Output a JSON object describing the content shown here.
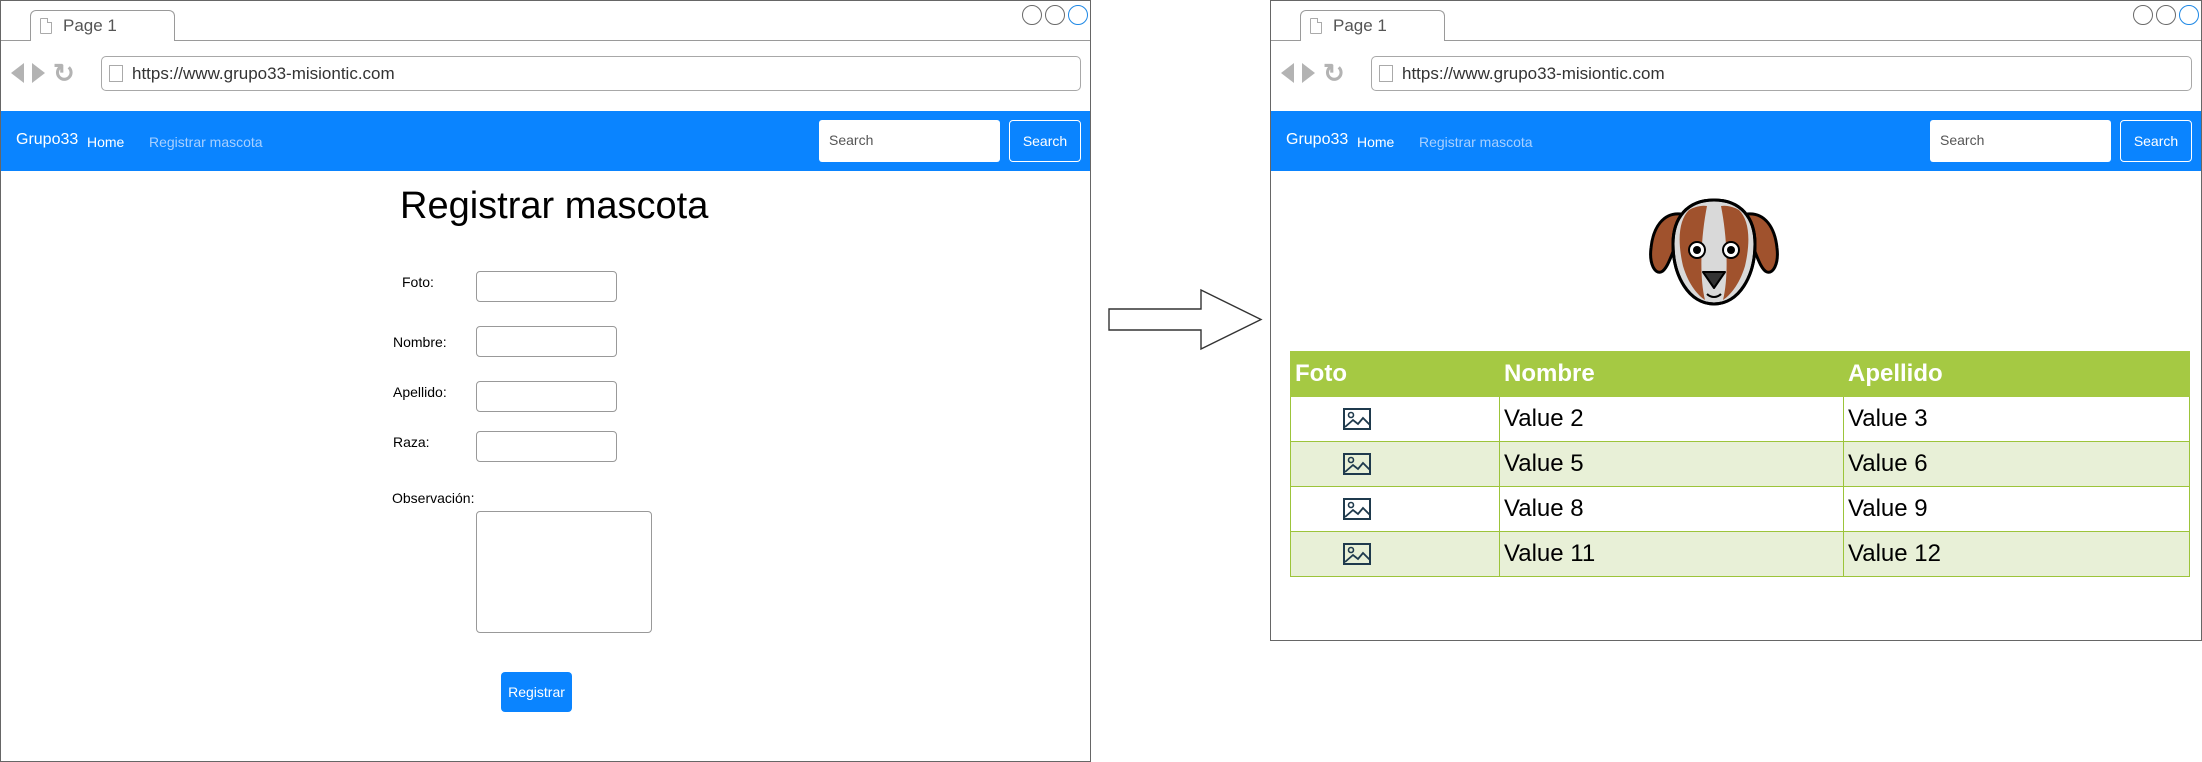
{
  "windows": {
    "form": {
      "tab_title": "Page 1",
      "url": "https://www.grupo33-misiontic.com",
      "navbar": {
        "brand": "Grupo33",
        "home": "Home",
        "register": "Registrar mascota",
        "search_placeholder": "Search",
        "search_button": "Search"
      },
      "title": "Registrar mascota",
      "labels": {
        "foto": "Foto:",
        "nombre": "Nombre:",
        "apellido": "Apellido:",
        "raza": "Raza:",
        "observacion": "Observación:"
      },
      "submit": "Registrar"
    },
    "list": {
      "tab_title": "Page 1",
      "url": "https://www.grupo33-misiontic.com",
      "navbar": {
        "brand": "Grupo33",
        "home": "Home",
        "register": "Registrar mascota",
        "search_placeholder": "Search",
        "search_button": "Search"
      },
      "table": {
        "headers": [
          "Foto",
          "Nombre",
          "Apellido"
        ],
        "rows": [
          {
            "nombre": "Value 2",
            "apellido": "Value 3"
          },
          {
            "nombre": "Value 5",
            "apellido": "Value 6"
          },
          {
            "nombre": "Value 8",
            "apellido": "Value 9"
          },
          {
            "nombre": "Value 11",
            "apellido": "Value 12"
          }
        ]
      }
    }
  },
  "colors": {
    "navbar": "#0a84ff",
    "table_header": "#a5c943",
    "table_alt_row": "#e8f0d7"
  }
}
